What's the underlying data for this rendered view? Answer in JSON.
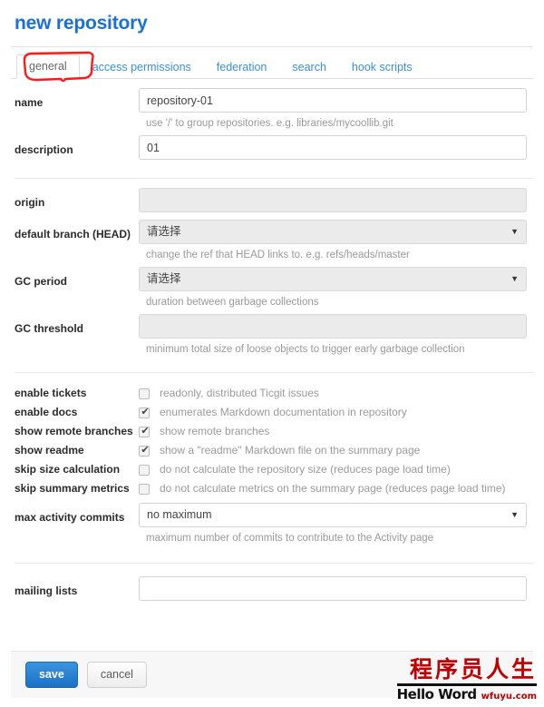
{
  "header": {
    "title": "new repository"
  },
  "tabs": [
    {
      "label": "general",
      "active": true
    },
    {
      "label": "access permissions",
      "active": false
    },
    {
      "label": "federation",
      "active": false
    },
    {
      "label": "search",
      "active": false
    },
    {
      "label": "hook scripts",
      "active": false
    }
  ],
  "annotation": {
    "shape": "hand-drawn-red-ellipse",
    "color": "#ff1a1a",
    "target": "general"
  },
  "fields": {
    "name": {
      "label": "name",
      "value": "repository-01",
      "placeholder": "",
      "hint": "use '/' to group repositories. e.g. libraries/mycoollib.git"
    },
    "description": {
      "label": "description",
      "value": "01",
      "placeholder": "",
      "hint": ""
    },
    "origin": {
      "label": "origin",
      "value": "",
      "placeholder": "",
      "hint": "",
      "disabled": true
    },
    "default_branch": {
      "label": "default branch (HEAD)",
      "value": "请选择",
      "hint": "change the ref that HEAD links to. e.g. refs/heads/master",
      "disabled": true
    },
    "gc_period": {
      "label": "GC period",
      "value": "请选择",
      "hint": "duration between garbage collections",
      "disabled": true
    },
    "gc_threshold": {
      "label": "GC threshold",
      "value": "",
      "hint": "minimum total size of loose objects to trigger early garbage collection",
      "disabled": true
    },
    "max_activity_commits": {
      "label": "max activity commits",
      "value": "no maximum",
      "hint": "maximum number of commits to contribute to the Activity page",
      "disabled": false
    },
    "mailing_lists": {
      "label": "mailing lists",
      "value": "",
      "placeholder": "",
      "hint": ""
    }
  },
  "checkboxes": [
    {
      "label": "enable tickets",
      "checked": false,
      "description": "readonly, distributed Ticgit issues"
    },
    {
      "label": "enable docs",
      "checked": true,
      "description": "enumerates Markdown documentation in repository"
    },
    {
      "label": "show remote branches",
      "checked": true,
      "description": "show remote branches"
    },
    {
      "label": "show readme",
      "checked": true,
      "description": "show a \"readme\" Markdown file on the summary page"
    },
    {
      "label": "skip size calculation",
      "checked": false,
      "description": "do not calculate the repository size (reduces page load time)"
    },
    {
      "label": "skip summary metrics",
      "checked": false,
      "description": "do not calculate metrics on the summary page (reduces page load time)"
    }
  ],
  "footer": {
    "save_label": "save",
    "cancel_label": "cancel"
  },
  "watermark": {
    "chinese": "程序员人生",
    "english": "Hello Word",
    "url": "wfuyu.com"
  },
  "colors": {
    "title": "#1a70d8",
    "tab_link": "#3a8fd8",
    "annotation": "#ff1a1a",
    "primary_button": "#1a71c4",
    "watermark_red": "#c00000"
  },
  "icons": {
    "select_caret": "▼",
    "check_mark": "✔"
  }
}
